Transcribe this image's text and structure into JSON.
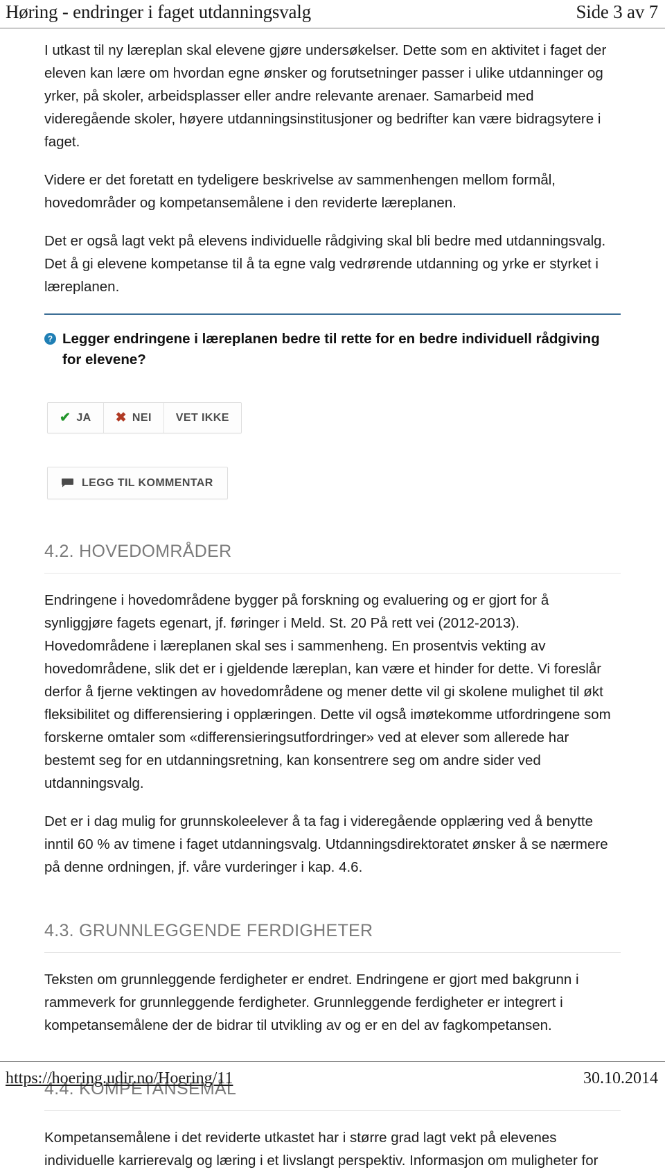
{
  "header": {
    "title": "Høring - endringer i faget utdanningsvalg",
    "page_label": "Side 3 av 7"
  },
  "footer": {
    "url": "https://hoering.udir.no/Hoering/11",
    "date": "30.10.2014"
  },
  "intro": {
    "p1": "I utkast til ny læreplan skal elevene gjøre undersøkelser. Dette som en aktivitet i faget der eleven kan lære om hvordan egne ønsker og forutsetninger passer i ulike utdanninger og yrker, på skoler, arbeidsplasser eller andre relevante arenaer. Samarbeid med videregående skoler, høyere utdanningsinstitusjoner og bedrifter kan være bidragsytere i faget.",
    "p2": "Videre er det foretatt en tydeligere beskrivelse av sammenhengen mellom formål, hovedområder og kompetansemålene i den reviderte læreplanen.",
    "p3": "Det er også lagt vekt på elevens individuelle rådgiving skal bli bedre med utdanningsvalg. Det å gi elevene kompetanse til å ta egne valg vedrørende utdanning og yrke er styrket i læreplanen."
  },
  "question": {
    "icon": "question-mark-circle-icon",
    "icon_color": "#1f7fb5",
    "text": "Legger endringene i læreplanen bedre til rette for en bedre individuell rådgiving for elevene?",
    "answers": [
      {
        "id": "ja",
        "label": "JA",
        "glyph": "✔",
        "glyph_name": "checkmark-icon",
        "glyph_color": "#22952b"
      },
      {
        "id": "nei",
        "label": "NEI",
        "glyph": "✖",
        "glyph_name": "cross-icon",
        "glyph_color": "#b03a24"
      },
      {
        "id": "vet-ikke",
        "label": "VET IKKE",
        "glyph": "",
        "glyph_name": "",
        "glyph_color": ""
      }
    ],
    "comment_button": {
      "label": "LEGG TIL KOMMENTAR",
      "icon": "comment-bubble-icon"
    }
  },
  "sections": [
    {
      "id": "hovedomrader",
      "title": "4.2. HOVEDOMRÅDER",
      "paragraphs": [
        "Endringene i hovedområdene bygger på forskning og evaluering og er gjort for å synliggjøre fagets egenart, jf. føringer i Meld. St. 20 På rett vei (2012-2013). Hovedområdene i læreplanen skal ses i sammenheng. En prosentvis vekting av hovedområdene, slik det er i gjeldende læreplan, kan være et hinder for dette. Vi foreslår derfor å fjerne vektingen av hovedområdene og mener dette vil gi skolene mulighet til økt fleksibilitet og differensiering i opplæringen. Dette vil også imøtekomme utfordringene som forskerne omtaler som «differensieringsutfordringer» ved at elever som allerede har bestemt seg for en utdanningsretning, kan konsentrere seg om andre sider ved utdanningsvalg.",
        "Det er i dag mulig for grunnskoleelever å ta fag i videregående opplæring ved å benytte inntil 60 % av timene i faget utdanningsvalg. Utdanningsdirektoratet ønsker å se nærmere på denne ordningen, jf. våre vurderinger i kap. 4.6."
      ]
    },
    {
      "id": "grunnleggende-ferdigheter",
      "title": "4.3. GRUNNLEGGENDE FERDIGHETER",
      "paragraphs": [
        "Teksten om grunnleggende ferdigheter er endret. Endringene er gjort med bakgrunn i rammeverk for grunnleggende ferdigheter. Grunnleggende ferdigheter er integrert i kompetansemålene der de bidrar til utvikling av og er en del av fagkompetansen."
      ]
    },
    {
      "id": "kompetansemal",
      "title": "4.4. KOMPETANSEMÅL",
      "paragraphs": [
        "Kompetansemålene i det reviderte utkastet har i større grad lagt vekt på elevenes individuelle karrierevalg og læring i et livslangt perspektiv. Informasjon om muligheter for"
      ]
    }
  ]
}
